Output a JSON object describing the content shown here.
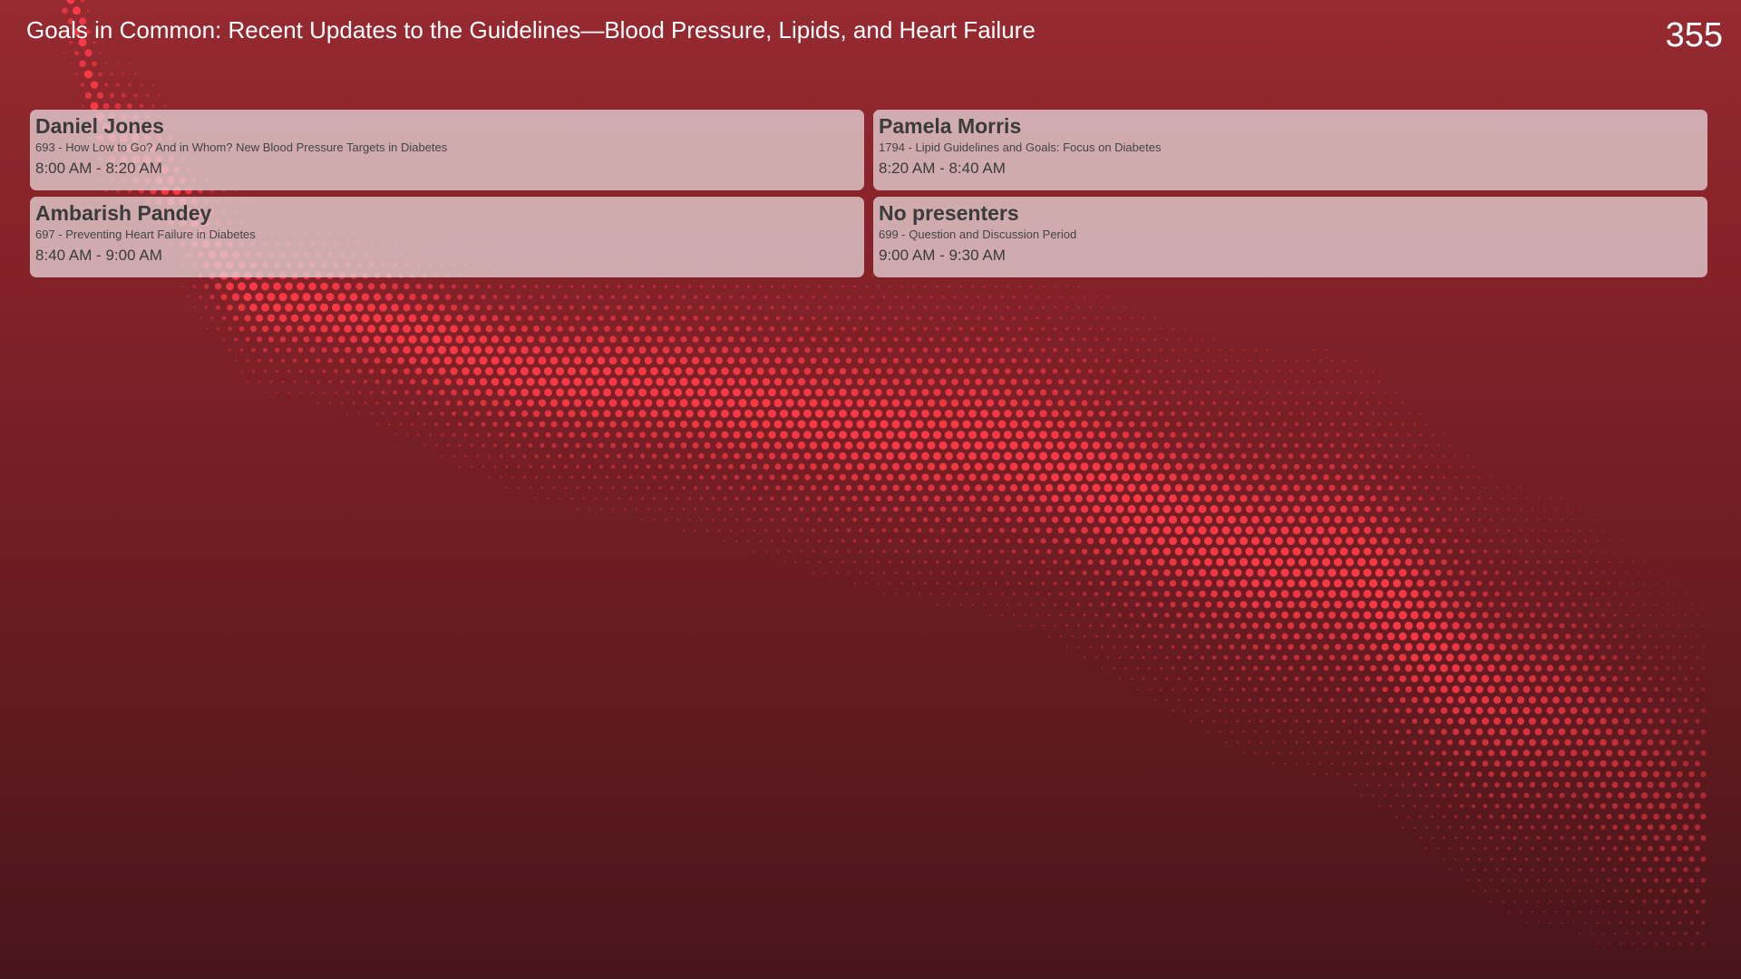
{
  "colors": {
    "background_top": "#962a31",
    "background_bottom": "#481519",
    "dot_color": "#ff3a48",
    "card_background": "#e1cdd0",
    "text_dark": "#3b3b3b",
    "header_text": "#ffffff"
  },
  "header": {
    "title": "Goals in Common: Recent Updates to the Guidelines—Blood Pressure, Lipids, and Heart Failure",
    "room": "355"
  },
  "sessions": [
    {
      "presenter": "Daniel Jones",
      "session": "693 - How Low to Go? And in Whom? New Blood Pressure Targets in Diabetes",
      "time": "8:00 AM - 8:20 AM"
    },
    {
      "presenter": "Pamela Morris",
      "session": "1794 - Lipid Guidelines and Goals: Focus on Diabetes",
      "time": "8:20 AM - 8:40 AM"
    },
    {
      "presenter": "Ambarish Pandey",
      "session": "697 - Preventing Heart Failure in Diabetes",
      "time": "8:40 AM - 9:00 AM"
    },
    {
      "presenter": "No presenters",
      "session": "699 - Question and Discussion Period",
      "time": "9:00 AM - 9:30 AM"
    }
  ]
}
